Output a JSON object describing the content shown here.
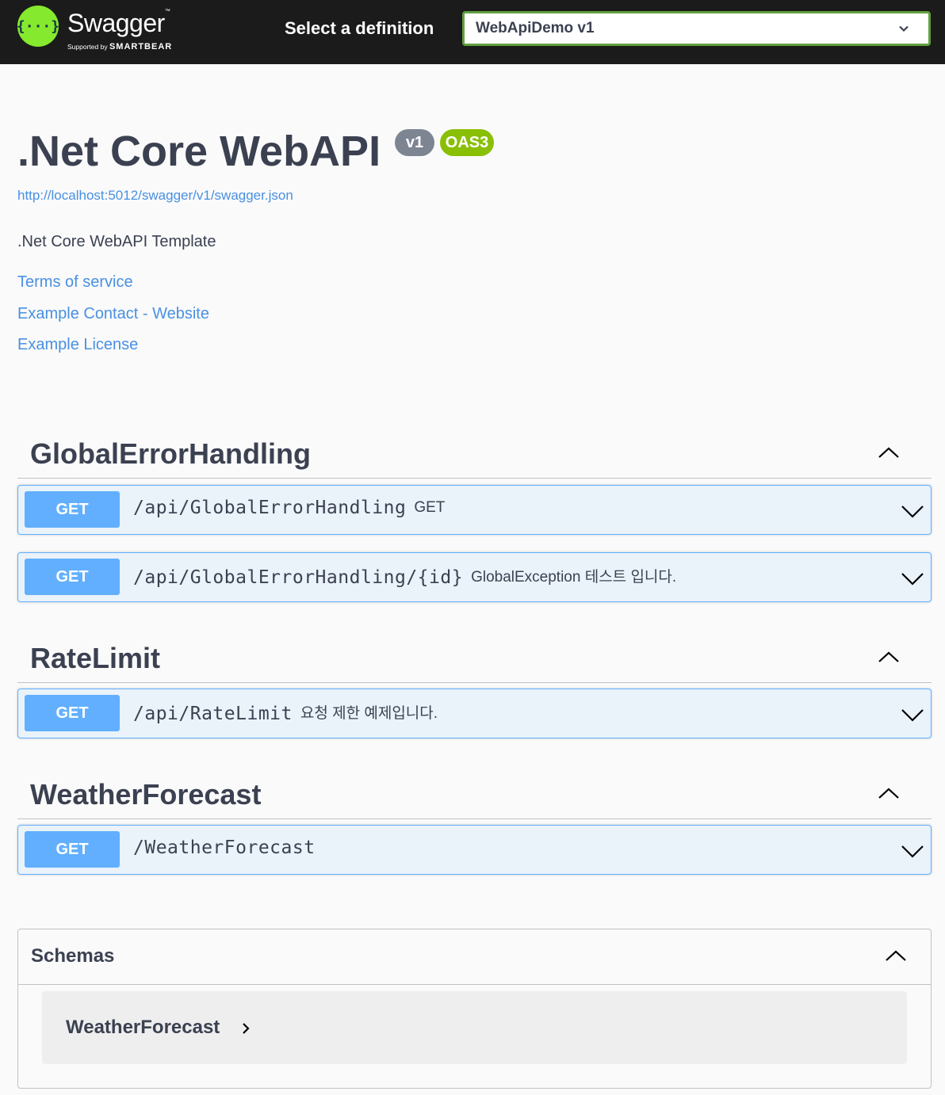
{
  "topbar": {
    "logo_glyph": "{···}",
    "brand_name": "Swagger",
    "brand_tm": "™",
    "supported_by": "Supported by",
    "supported_company": "SMARTBEAR",
    "select_label": "Select a definition",
    "selected_definition": "WebApiDemo v1"
  },
  "info": {
    "title": ".Net Core WebAPI",
    "version_badge": "v1",
    "oas_badge": "OAS3",
    "spec_url": "http://localhost:5012/swagger/v1/swagger.json",
    "description": ".Net Core WebAPI Template",
    "links": {
      "terms": "Terms of service",
      "contact": "Example Contact - Website",
      "license": "Example License"
    }
  },
  "tags": [
    {
      "name": "GlobalErrorHandling",
      "operations": [
        {
          "method": "GET",
          "path": "/api/GlobalErrorHandling",
          "summary": "GET"
        },
        {
          "method": "GET",
          "path": "/api/GlobalErrorHandling/{id}",
          "summary": "GlobalException 테스트 입니다."
        }
      ]
    },
    {
      "name": "RateLimit",
      "operations": [
        {
          "method": "GET",
          "path": "/api/RateLimit",
          "summary": "요청 제한 예제입니다."
        }
      ]
    },
    {
      "name": "WeatherForecast",
      "operations": [
        {
          "method": "GET",
          "path": "/WeatherForecast",
          "summary": ""
        }
      ]
    }
  ],
  "schemas": {
    "title": "Schemas",
    "models": [
      {
        "name": "WeatherForecast"
      }
    ]
  },
  "colors": {
    "topbar_bg": "#1b1b1b",
    "logo_green": "#85ea2d",
    "select_border": "#62a03f",
    "get_blue": "#61affe",
    "link_blue": "#4990e2",
    "oas_green": "#89bf04",
    "version_gray": "#7d8492",
    "text": "#3b4151"
  },
  "icons": {
    "dropdown": "chevron-down-icon",
    "tag_toggle": "chevron-up-icon",
    "op_toggle": "chevron-down-icon",
    "model_expand": "chevron-right-icon"
  }
}
